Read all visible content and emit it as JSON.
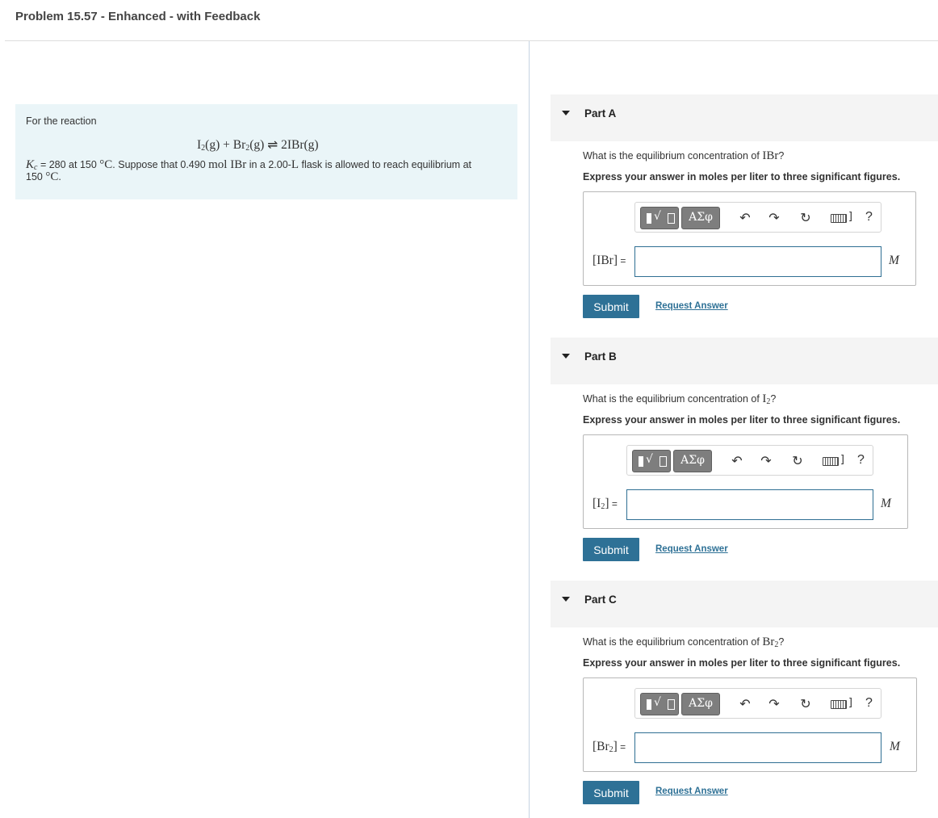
{
  "page": {
    "title": "Problem 15.57 - Enhanced - with Feedback"
  },
  "problem": {
    "intro": "For the reaction",
    "equation": {
      "r1": "I",
      "r1_sub": "2",
      "r1_state": "(g) + Br",
      "r2_sub": "2",
      "r2_state": "(g)",
      "arrow": "⇌",
      "product": "2IBr(g)"
    },
    "kc_symbol": "K",
    "kc_sub": "c",
    "text_1": " = 280 at 150 ",
    "temp_unit": "°C",
    "text_2": ". Suppose that 0.490 ",
    "amount": "mol IBr",
    "text_3": " in a 2.00-",
    "volume_unit": "L",
    "text_4": " flask is allowed to reach equilibrium at",
    "text_5": "150 ",
    "temp_unit_2": "°C",
    "text_6": "."
  },
  "toolbar": {
    "greek_label": "ΑΣφ",
    "undo_icon": "undo-icon",
    "redo_icon": "redo-icon",
    "reset_icon": "reset-icon",
    "keyboard_icon": "keyboard-icon",
    "help_label": "?"
  },
  "parts": [
    {
      "label": "Part A",
      "question_prefix": "What is the equilibrium concentration of ",
      "species": "IBr",
      "species_sub": "",
      "question_suffix": "?",
      "instruction": "Express your answer in moles per liter to three significant figures.",
      "var_open": "[IBr]",
      "var_sub": "",
      "var_close": "",
      "var_eq": " =",
      "input_value": "",
      "unit": "M",
      "submit_label": "Submit",
      "request_label": "Request Answer"
    },
    {
      "label": "Part B",
      "question_prefix": "What is the equilibrium concentration of ",
      "species": "I",
      "species_sub": "2",
      "question_suffix": "?",
      "instruction": "Express your answer in moles per liter to three significant figures.",
      "var_open": "[I",
      "var_sub": "2",
      "var_close": "]",
      "var_eq": " =",
      "input_value": "",
      "unit": "M",
      "submit_label": "Submit",
      "request_label": "Request Answer"
    },
    {
      "label": "Part C",
      "question_prefix": "What is the equilibrium concentration of ",
      "species": "Br",
      "species_sub": "2",
      "question_suffix": "?",
      "instruction": "Express your answer in moles per liter to three significant figures.",
      "var_open": "[Br",
      "var_sub": "2",
      "var_close": "]",
      "var_eq": " =",
      "input_value": "",
      "unit": "M",
      "submit_label": "Submit",
      "request_label": "Request Answer"
    }
  ]
}
